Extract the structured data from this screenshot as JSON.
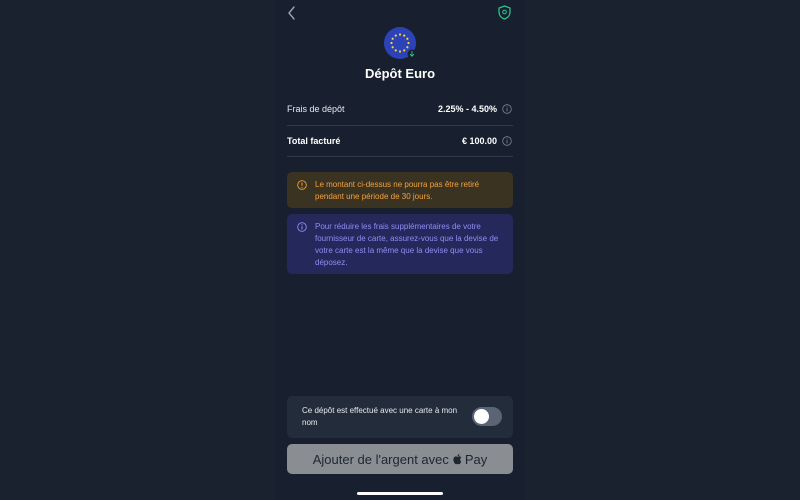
{
  "header": {
    "back_icon": "chevron-left-icon",
    "shield_icon": "shield-icon"
  },
  "currency": {
    "flag": "eu-flag",
    "title": "Dépôt Euro"
  },
  "fees": {
    "label": "Frais de dépôt",
    "value": "2.25% - 4.50%"
  },
  "total": {
    "label": "Total facturé",
    "value": "€ 100.00"
  },
  "alerts": {
    "warning": "Le montant ci-dessus ne pourra pas être retiré pendant une période de 30 jours.",
    "info": "Pour réduire les frais supplémentaires de votre fournisseur de carte, assurez-vous que la devise de votre carte est la même que la devise que vous déposez."
  },
  "card_toggle": {
    "label": "Ce dépôt est effectué avec une carte à mon nom",
    "checked": false
  },
  "pay_button": {
    "label": "Ajouter de l'argent avec",
    "pay_word": "Pay"
  },
  "colors": {
    "background": "#182030",
    "warning_text": "#f5a03c",
    "info_text": "#8f8df5",
    "accent_green": "#2fc98a"
  }
}
